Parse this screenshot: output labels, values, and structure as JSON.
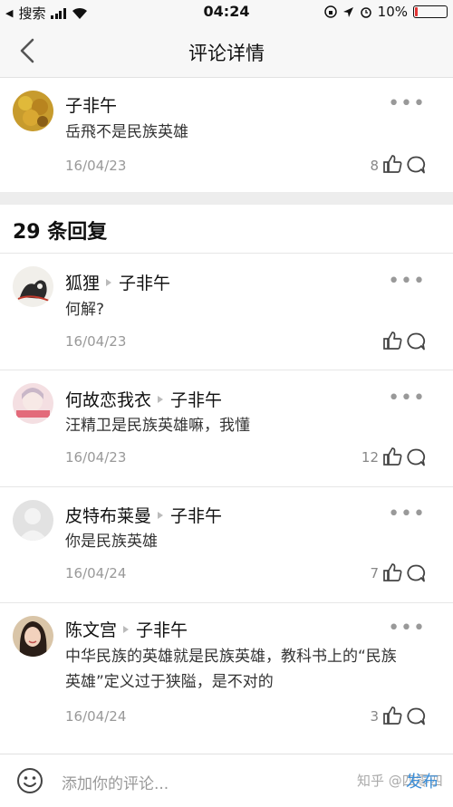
{
  "status_bar": {
    "carrier": "搜索",
    "time": "04:24",
    "battery_percent": "10%",
    "battery_level": 0.1,
    "battery_color": "#e33333"
  },
  "header": {
    "title": "评论详情"
  },
  "main_comment": {
    "author": "子非午",
    "text": "岳飛不是民族英雄",
    "date": "16/04/23",
    "likes": "8"
  },
  "reply_count_label": "29 条回复",
  "replies": [
    {
      "author": "狐狸",
      "reply_to": "子非午",
      "text": "何解?",
      "date": "16/04/23",
      "likes": ""
    },
    {
      "author": "何故恋我衣",
      "reply_to": "子非午",
      "text": "汪精卫是民族英雄嘛，我懂",
      "date": "16/04/23",
      "likes": "12"
    },
    {
      "author": "皮特布莱曼",
      "reply_to": "子非午",
      "text": "你是民族英雄",
      "date": "16/04/24",
      "likes": "7"
    },
    {
      "author": "陈文宫",
      "reply_to": "子非午",
      "text": "中华民族的英雄就是民族英雄，教科书上的“民族英雄”定义过于狭隘，是不对的",
      "date": "16/04/24",
      "likes": "3"
    }
  ],
  "more_label": "•••",
  "composer": {
    "placeholder": "添加你的评论...",
    "send_label": "发布",
    "watermark": "知乎 @四零四"
  },
  "colors": {
    "accent": "#3d8fd8"
  }
}
